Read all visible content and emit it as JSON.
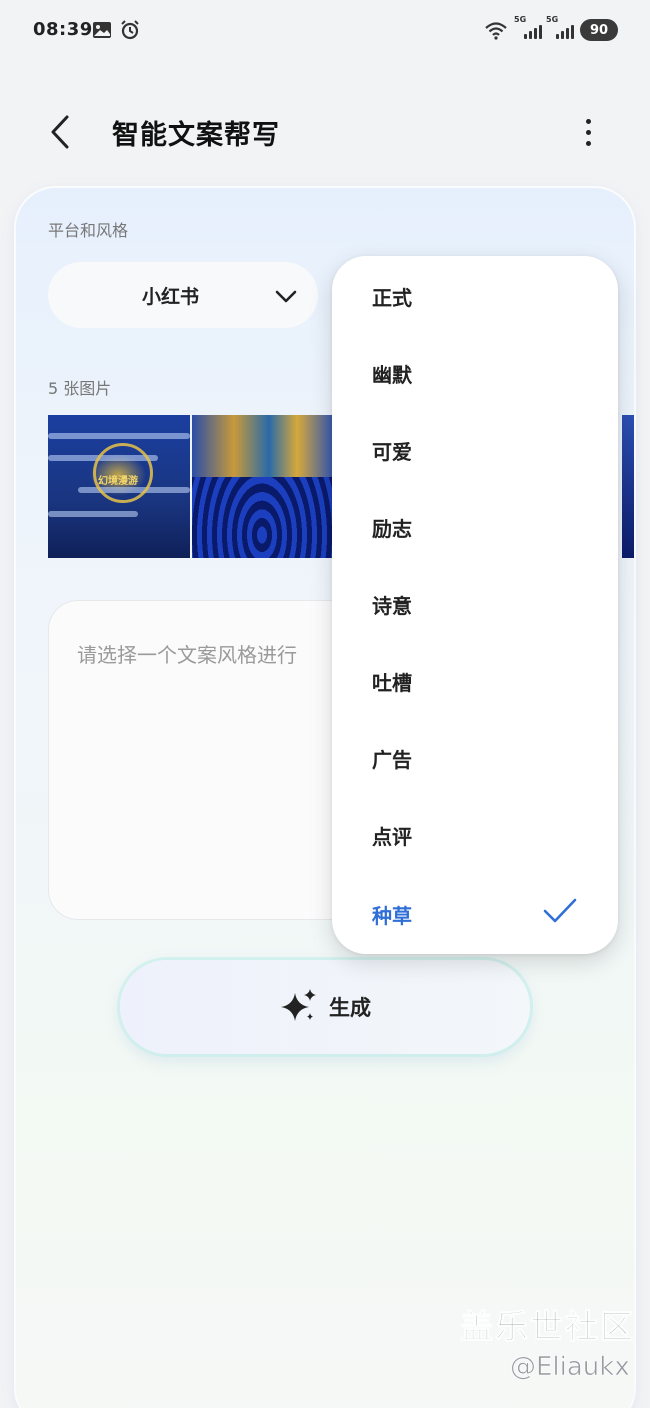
{
  "status_bar": {
    "time": "08:39",
    "battery": "90",
    "network_labels": [
      "5G",
      "5G"
    ]
  },
  "header": {
    "title": "智能文案帮写"
  },
  "form": {
    "platform_label": "平台和风格",
    "platform_value": "小红书",
    "images_label": "5 张图片",
    "thumbnail_caption": "幻境漫游",
    "placeholder": "请选择一个文案风格进行"
  },
  "dropdown": {
    "options": [
      "正式",
      "幽默",
      "可爱",
      "励志",
      "诗意",
      "吐槽",
      "广告",
      "点评",
      "种草"
    ],
    "selected": "种草",
    "selected_color": "#2f6fd6"
  },
  "generate_button": {
    "label": "生成"
  },
  "watermark": {
    "line1": "盖乐世社区",
    "line2": "@Eliaukx"
  }
}
